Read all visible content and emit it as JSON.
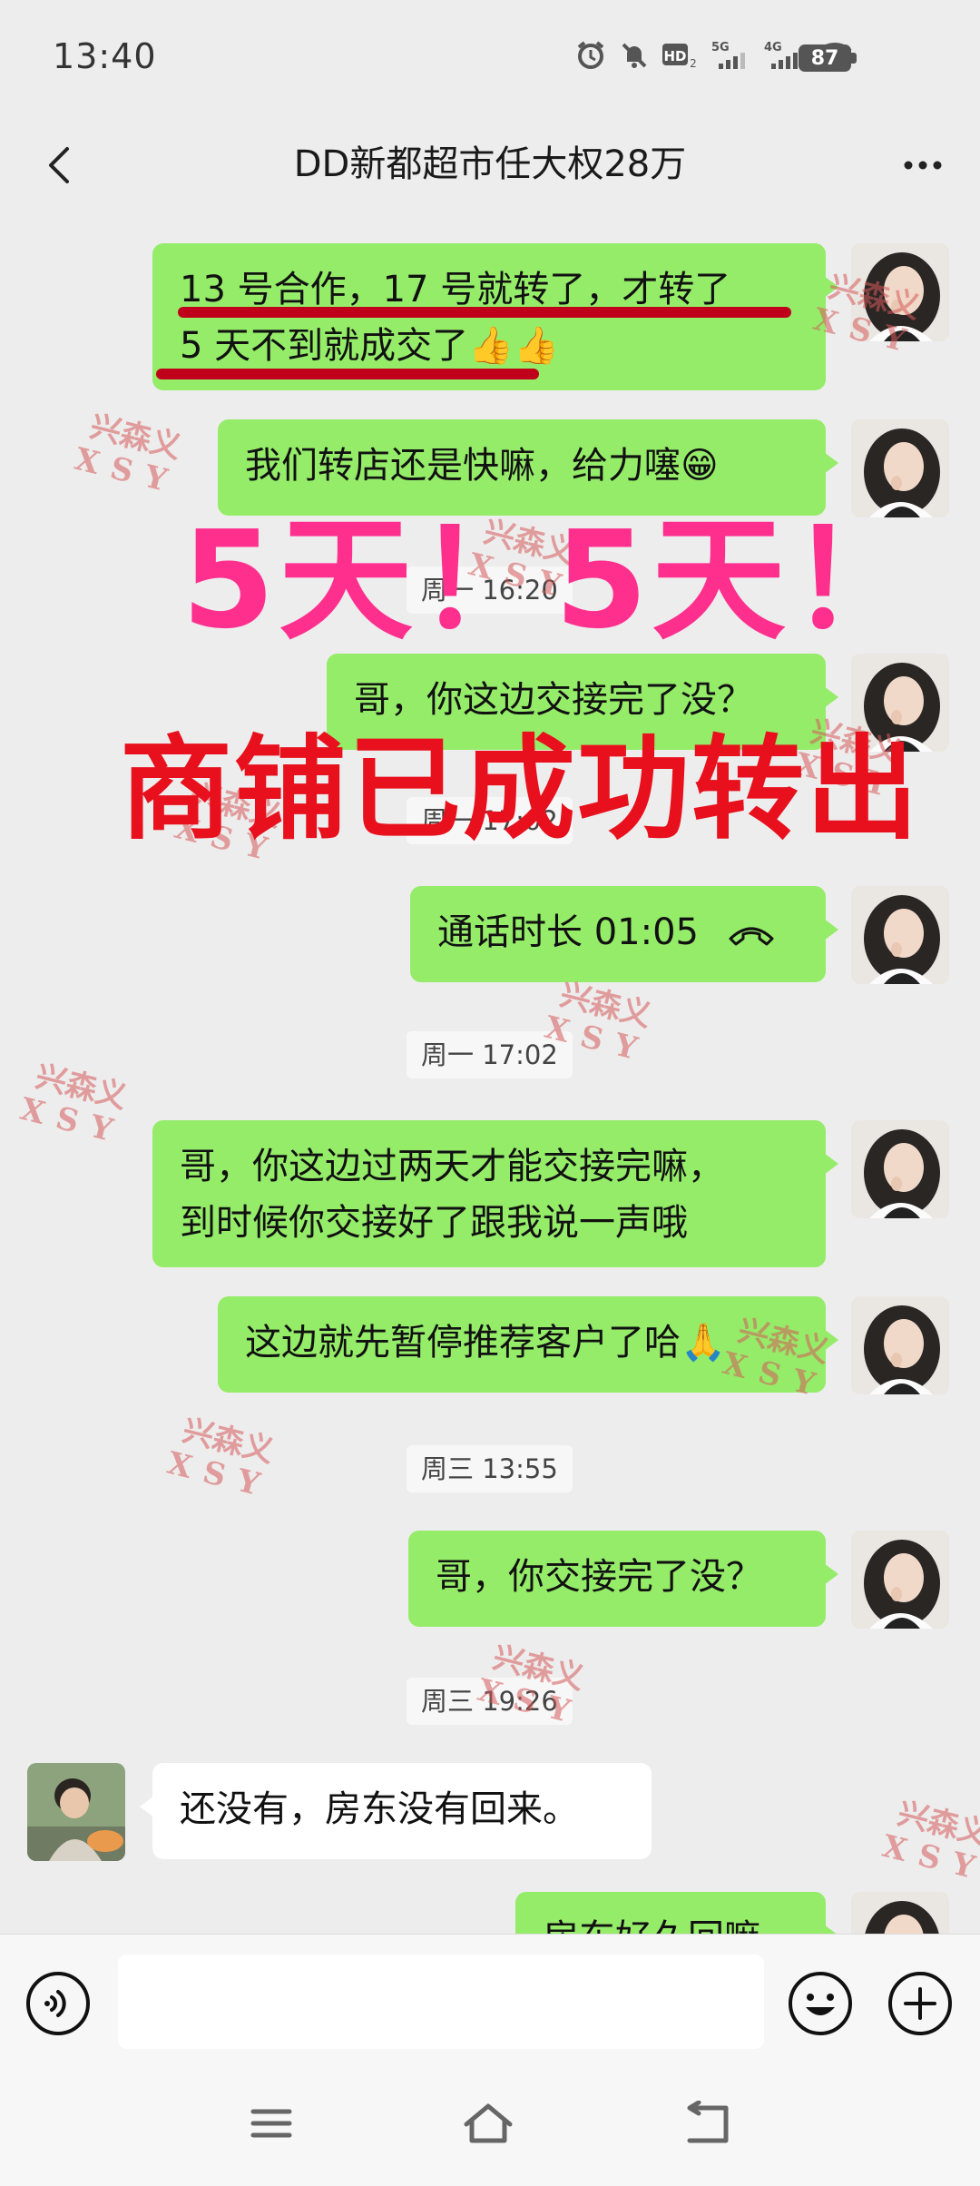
{
  "status_bar": {
    "time": "13:40",
    "battery": "87",
    "network_labels": [
      "HD",
      "5G",
      "4G"
    ]
  },
  "header": {
    "title": "DD新都超市任大权28万",
    "back_icon": "chevron-left-icon",
    "more_icon": "more-dots-icon"
  },
  "messages": [
    {
      "type": "sent",
      "lines": [
        "13 号合作，17 号就转了，才转了",
        "5 天不到就成交了"
      ],
      "emoji": "👍👍"
    },
    {
      "type": "sent",
      "text": "我们转店还是快嘛，给力噻",
      "emoji": "😁"
    },
    {
      "type": "time",
      "text": "周一 16:20"
    },
    {
      "type": "sent",
      "text": "哥，你这边交接完了没？"
    },
    {
      "type": "time",
      "text": "周一 17:02"
    },
    {
      "type": "sent",
      "text": "通话时长 01:05",
      "icon": "phone-hangup-icon"
    },
    {
      "type": "time",
      "text": "周一 17:02"
    },
    {
      "type": "sent",
      "lines": [
        "哥，你这边过两天才能交接完嘛，",
        "到时候你交接好了跟我说一声哦"
      ]
    },
    {
      "type": "sent",
      "text": "这边就先暂停推荐客户了哈",
      "emoji": "🙏"
    },
    {
      "type": "time",
      "text": "周三 13:55"
    },
    {
      "type": "sent",
      "text": "哥，你交接完了没？"
    },
    {
      "type": "time",
      "text": "周三 19:26"
    },
    {
      "type": "received",
      "text": "还没有，房东没有回来。"
    },
    {
      "type": "sent",
      "text": "房东好久回嘛"
    }
  ],
  "overlay": {
    "headline": "5天！5天！",
    "subline": "商铺已成功转出",
    "headline_color": "#ff2f8e",
    "subline_color": "#e8101d"
  },
  "watermark": {
    "cn": "兴森义",
    "en": "XSY",
    "color": "#d65a5a"
  },
  "input_bar": {
    "voice_icon": "voice-icon",
    "emoji_icon": "emoji-icon",
    "plus_icon": "plus-icon"
  },
  "nav_bar": {
    "icons": [
      "menu-icon",
      "home-icon",
      "back-icon"
    ]
  },
  "colors": {
    "sent_bubble": "#95ec69",
    "received_bubble": "#ffffff",
    "background": "#ededed",
    "underline": "#c0001b"
  }
}
